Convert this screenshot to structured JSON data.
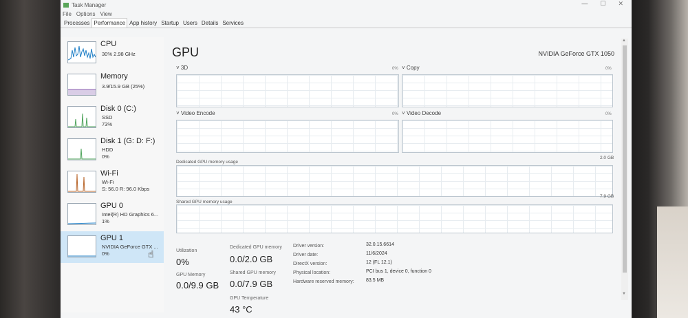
{
  "window": {
    "title": "Task Manager",
    "controls": [
      "—",
      "☐",
      "✕"
    ]
  },
  "menu": [
    "File",
    "Options",
    "View"
  ],
  "tabs": [
    {
      "label": "Processes"
    },
    {
      "label": "Performance",
      "active": true
    },
    {
      "label": "App history"
    },
    {
      "label": "Startup"
    },
    {
      "label": "Users"
    },
    {
      "label": "Details"
    },
    {
      "label": "Services"
    }
  ],
  "sidebar": {
    "items": [
      {
        "name": "CPU",
        "lines": [
          "30%  2.98 GHz"
        ]
      },
      {
        "name": "Memory",
        "lines": [
          "3.9/15.9 GB (25%)"
        ]
      },
      {
        "name": "Disk 0 (C:)",
        "lines": [
          "SSD",
          "73%"
        ]
      },
      {
        "name": "Disk 1 (G: D: F:)",
        "lines": [
          "HDD",
          "0%"
        ]
      },
      {
        "name": "Wi-Fi",
        "lines": [
          "Wi-Fi",
          "S: 56.0  R: 96.0 Kbps"
        ]
      },
      {
        "name": "GPU 0",
        "lines": [
          "Intel(R) HD Graphics 6...",
          "1%"
        ]
      },
      {
        "name": "GPU 1",
        "lines": [
          "NVIDIA GeForce GTX ...",
          "0%"
        ],
        "selected": true
      }
    ]
  },
  "main": {
    "title": "GPU",
    "model": "NVIDIA GeForce GTX 1050",
    "engines": [
      {
        "label": "3D",
        "pct": "0%"
      },
      {
        "label": "Copy",
        "pct": "0%"
      },
      {
        "label": "Video Encode",
        "pct": "0%"
      },
      {
        "label": "Video Decode",
        "pct": "0%"
      }
    ],
    "dedicated": {
      "label": "Dedicated GPU memory usage",
      "max": "2.0 GB"
    },
    "shared": {
      "label": "Shared GPU memory usage",
      "max": "7.9 GB"
    },
    "stats": {
      "utilization": {
        "label": "Utilization",
        "value": "0%"
      },
      "dedicated_memory": {
        "label": "Dedicated GPU memory",
        "value": "0.0/2.0 GB"
      },
      "gpu_memory": {
        "label": "GPU Memory",
        "value": "0.0/9.9 GB"
      },
      "shared_memory": {
        "label": "Shared GPU memory",
        "value": "0.0/7.9 GB"
      },
      "temperature": {
        "label": "GPU Temperature",
        "value": "43 °C"
      }
    },
    "info": [
      {
        "key": "Driver version:",
        "value": "32.0.15.6614"
      },
      {
        "key": "Driver date:",
        "value": "11/6/2024"
      },
      {
        "key": "DirectX version:",
        "value": "12 (FL 12.1)"
      },
      {
        "key": "Physical location:",
        "value": "PCI bus 1, device 0, function 0"
      },
      {
        "key": "Hardware reserved memory:",
        "value": "83.5 MB"
      }
    ]
  }
}
